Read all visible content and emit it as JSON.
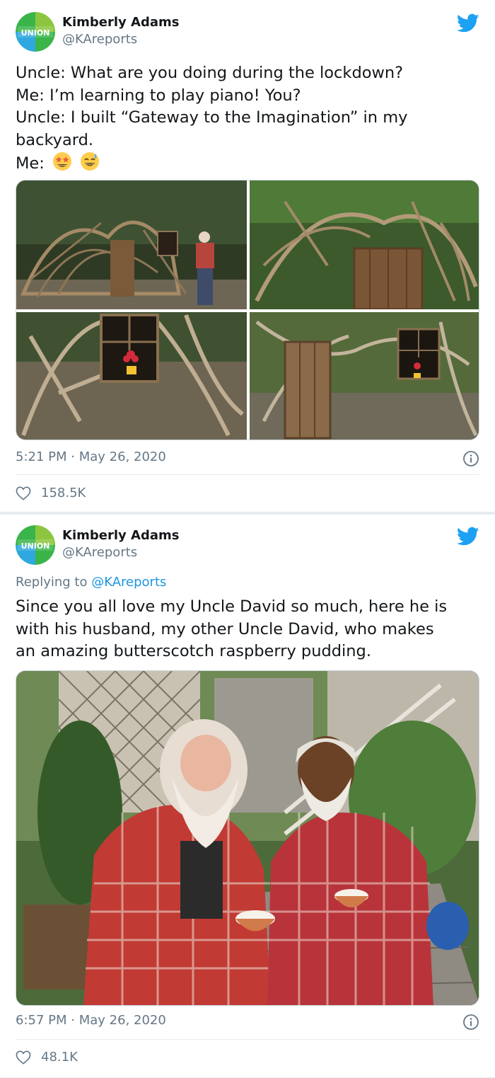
{
  "colors": {
    "twitter_blue": "#1da1f2",
    "text": "#14171a",
    "muted": "#657786",
    "union_green": "#39b54a",
    "union_blue": "#2fa8e0"
  },
  "tweets": [
    {
      "author": {
        "name": "Kimberly Adams",
        "handle": "@KAreports",
        "avatar_text": "UNION",
        "avatar_icon": "union-logo"
      },
      "text_lines": [
        "Uncle: What are you doing during the lockdown?",
        "Me: I’m learning to play piano! You?",
        "Uncle: I built “Gateway to the Imagination” in my",
        "backyard.",
        "Me:"
      ],
      "emojis": [
        "star-struck-face",
        "grinning-sweat-face"
      ],
      "media_count": 4,
      "time": "5:21 PM",
      "date": "May 26, 2020",
      "time_sep": "·",
      "likes": "158.5K"
    },
    {
      "author": {
        "name": "Kimberly Adams",
        "handle": "@KAreports",
        "avatar_text": "UNION",
        "avatar_icon": "union-logo"
      },
      "replying_prefix": "Replying to",
      "replying_to": "@KAreports",
      "text_lines": [
        "Since you all love my Uncle David so much, here he is",
        "with his husband, my other Uncle David, who makes",
        "an amazing butterscotch raspberry pudding."
      ],
      "media_count": 1,
      "time": "6:57 PM",
      "date": "May 26, 2020",
      "time_sep": "·",
      "likes": "48.1K"
    }
  ]
}
